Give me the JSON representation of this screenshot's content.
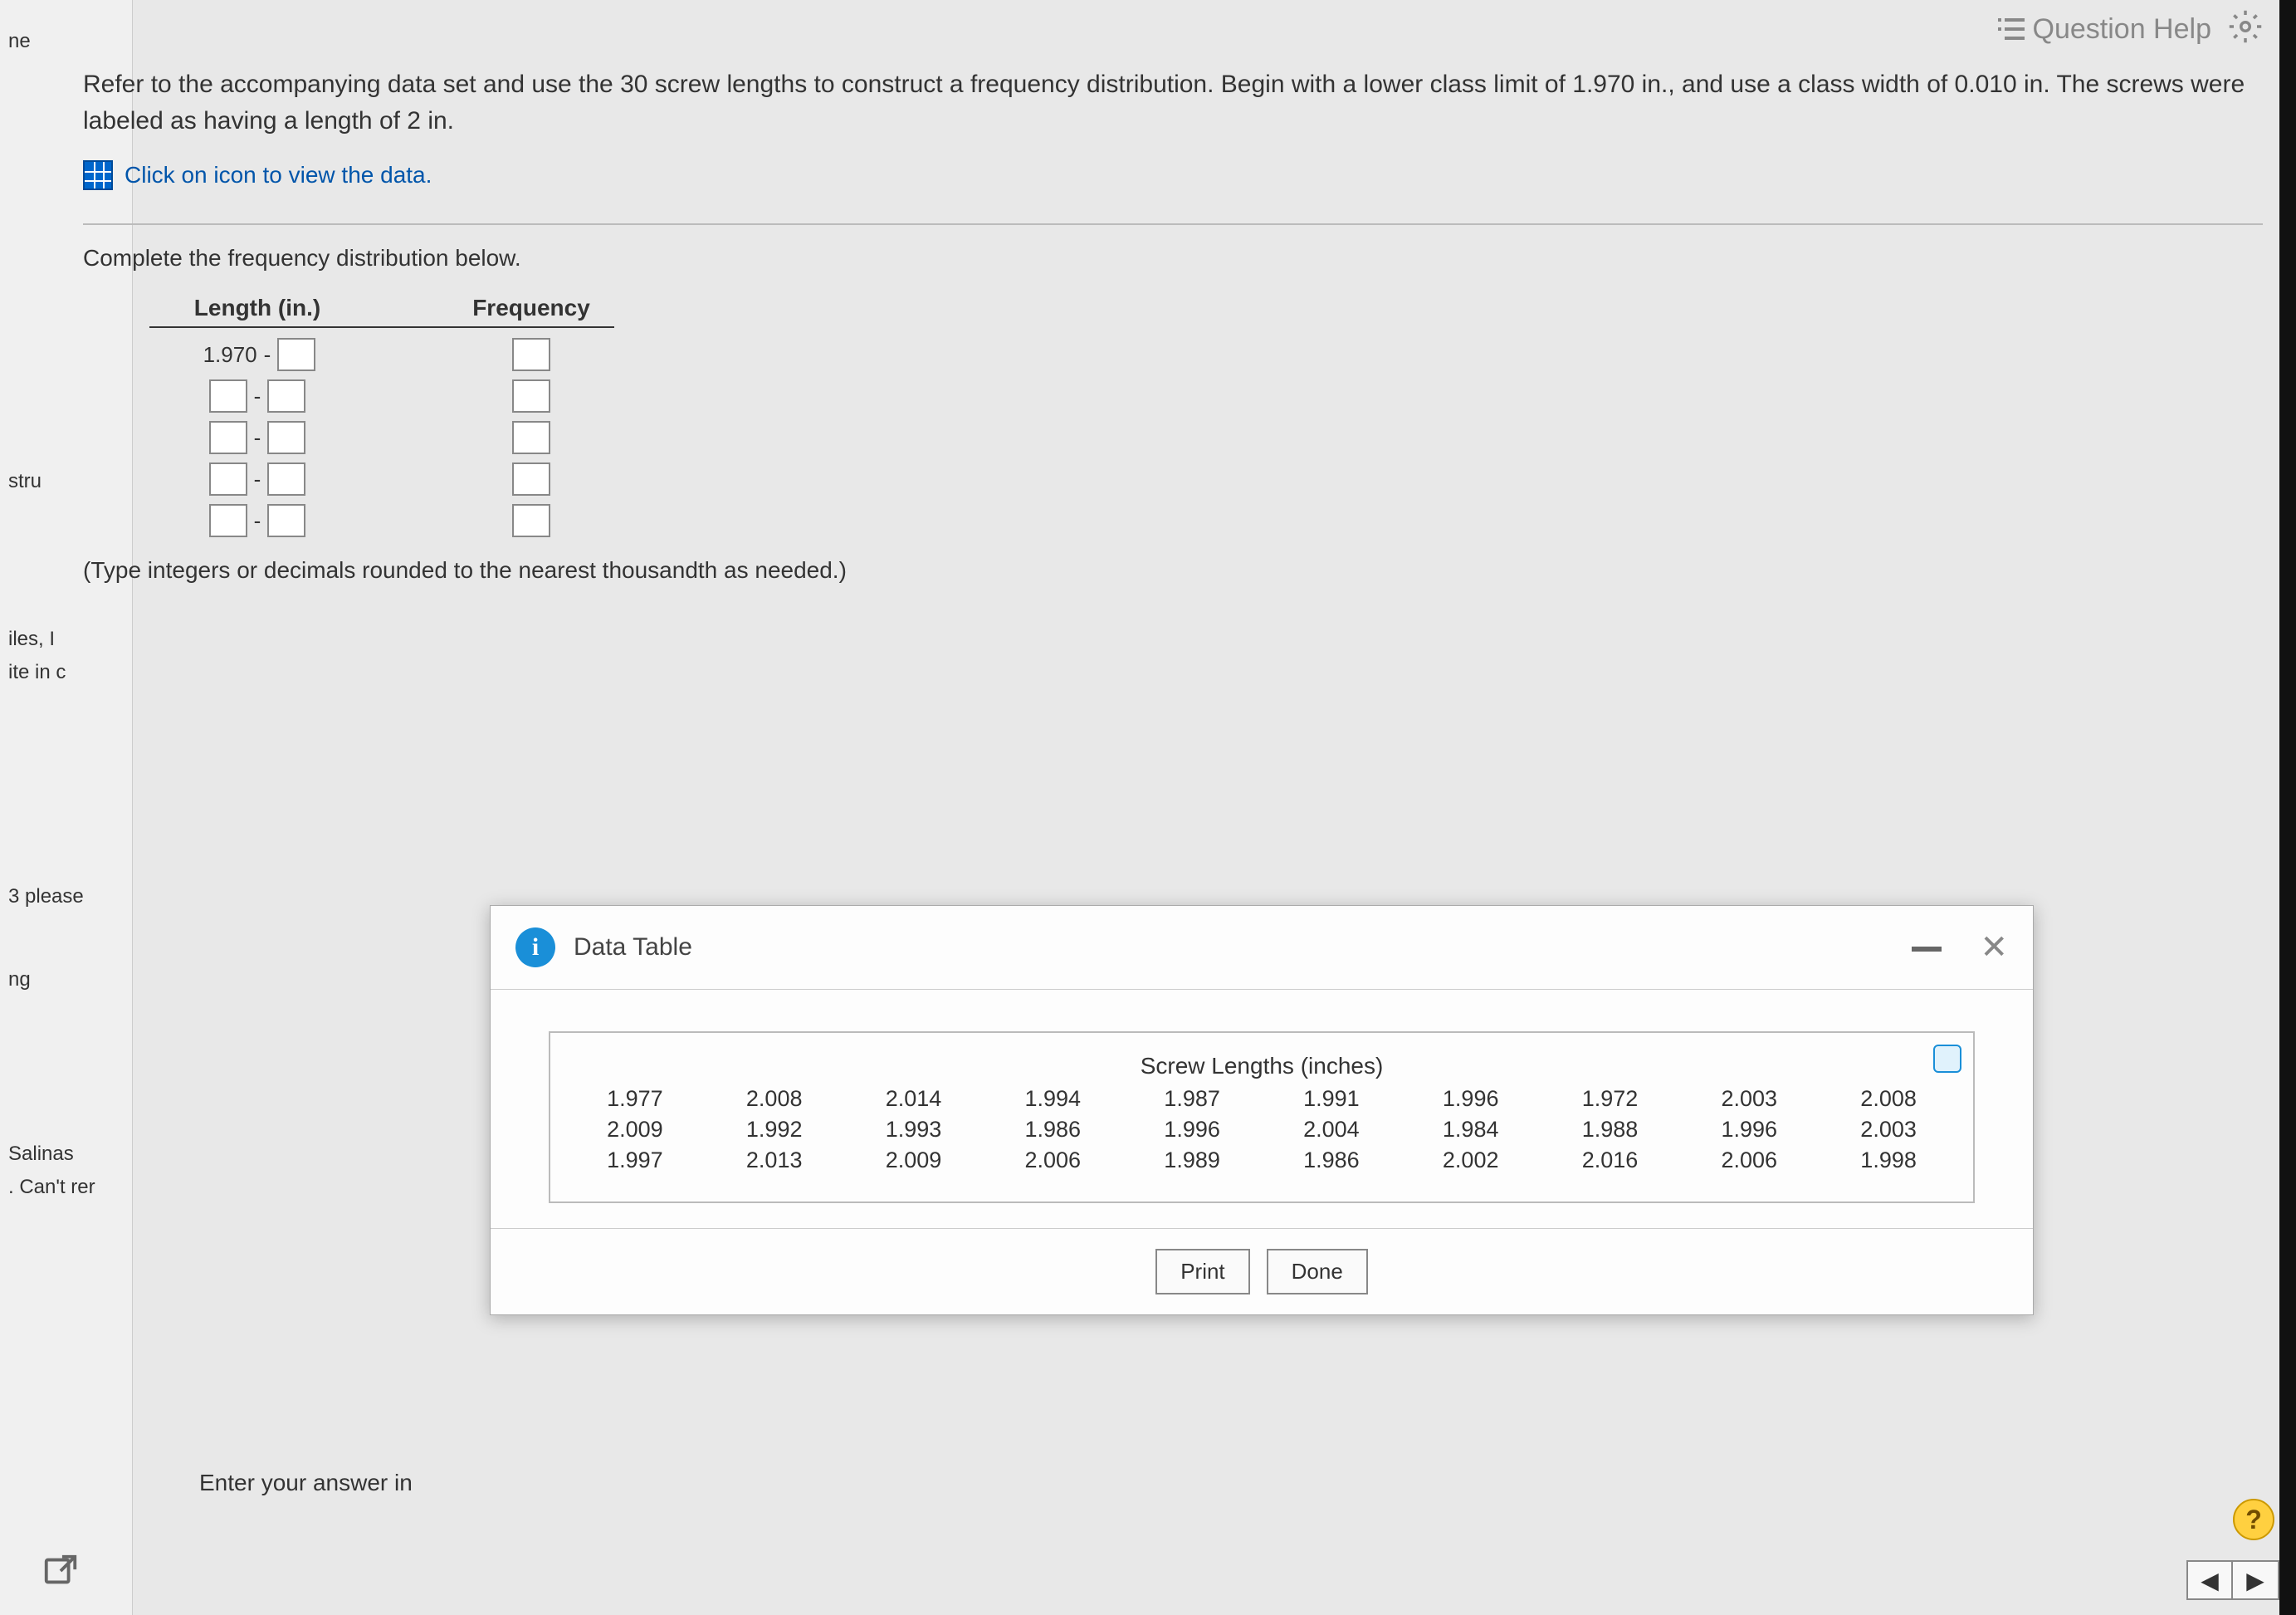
{
  "header": {
    "question_help": "Question Help"
  },
  "left_panel": {
    "items": [
      "ne",
      "stru",
      "iles, I",
      "ite in c",
      "3 please",
      "ng",
      "Salinas",
      ". Can't rer"
    ]
  },
  "question": {
    "text": "Refer to the accompanying data set and use the 30 screw lengths to construct a frequency distribution. Begin with a lower class limit of 1.970 in., and use a class width of 0.010 in. The screws were labeled as having a length of 2 in.",
    "view_data": "Click on icon to view the data.",
    "section_label": "Complete the frequency distribution below.",
    "instruction": "(Type integers or decimals rounded to the nearest thousandth as needed.)"
  },
  "freq_table": {
    "headers": {
      "length": "Length (in.)",
      "frequency": "Frequency"
    },
    "first_fixed": "1.970",
    "dash": "-"
  },
  "modal": {
    "title": "Data Table",
    "data_title": "Screw Lengths (inches)",
    "rows": [
      [
        "1.977",
        "2.008",
        "2.014",
        "1.994",
        "1.987",
        "1.991",
        "1.996",
        "1.972",
        "2.003",
        "2.008"
      ],
      [
        "2.009",
        "1.992",
        "1.993",
        "1.986",
        "1.996",
        "2.004",
        "1.984",
        "1.988",
        "1.996",
        "2.003"
      ],
      [
        "1.997",
        "2.013",
        "2.009",
        "2.006",
        "1.989",
        "1.986",
        "2.002",
        "2.016",
        "2.006",
        "1.998"
      ]
    ],
    "print": "Print",
    "done": "Done"
  },
  "footer": {
    "enter_answer": "Enter your answer in",
    "help_badge": "?"
  },
  "nav": {
    "prev": "◀",
    "next": "▶"
  }
}
